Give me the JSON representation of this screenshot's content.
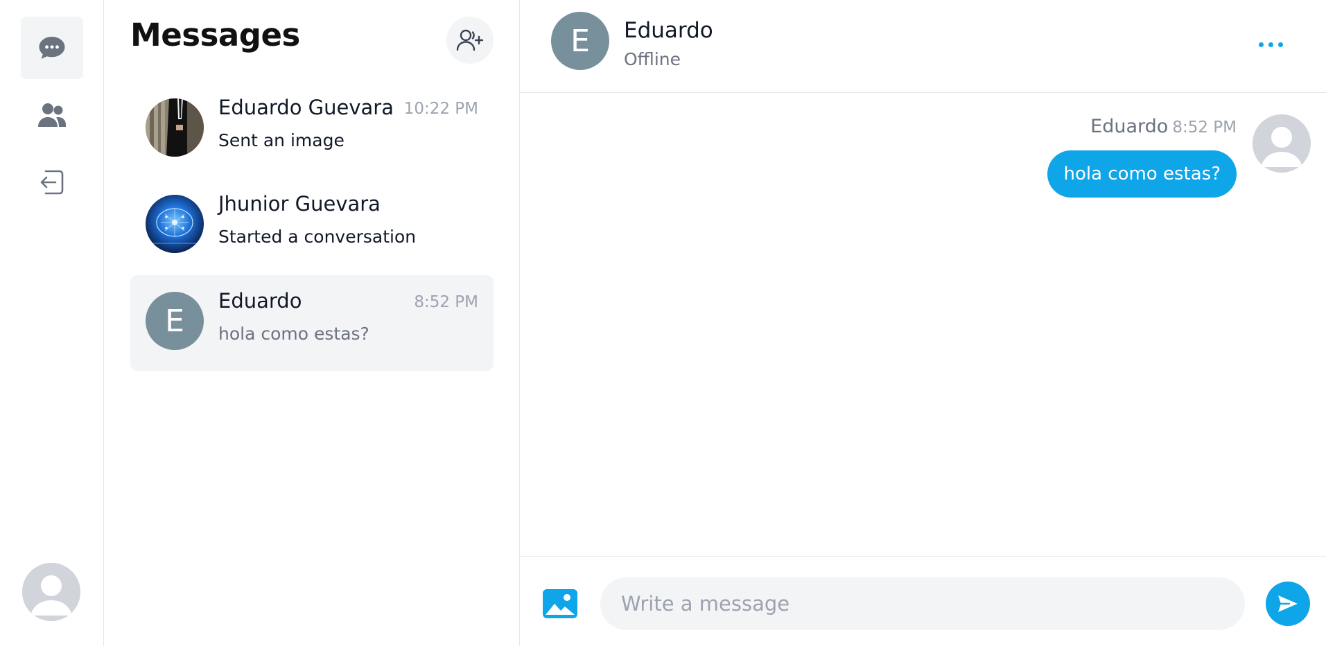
{
  "nav": {
    "items": [
      {
        "name": "messages",
        "icon": "chat-bubble-icon",
        "active": true
      },
      {
        "name": "contacts",
        "icon": "users-icon",
        "active": false
      },
      {
        "name": "logout",
        "icon": "logout-icon",
        "active": false
      }
    ],
    "user_avatar_icon": "default-user-icon"
  },
  "list": {
    "title": "Messages",
    "add_contact_icon": "user-plus-icon",
    "conversations": [
      {
        "name": "Eduardo Guevara",
        "time": "10:22 PM",
        "preview": "Sent an image",
        "avatar": "photo",
        "selected": false
      },
      {
        "name": "Jhunior Guevara",
        "time": "",
        "preview": "Started a conversation",
        "avatar": "photo",
        "selected": false
      },
      {
        "name": "Eduardo",
        "time": "8:52 PM",
        "preview": "hola como estas?",
        "avatar_letter": "E",
        "selected": true
      }
    ]
  },
  "chat": {
    "contact": {
      "name": "Eduardo",
      "status": "Offline",
      "avatar_letter": "E"
    },
    "more_icon": "more-horizontal-icon",
    "messages": [
      {
        "author": "Eduardo",
        "time": "8:52 PM",
        "text": "hola como estas?"
      }
    ],
    "composer": {
      "placeholder": "Write a message",
      "value": "",
      "image_icon": "image-icon",
      "send_icon": "send-icon"
    }
  },
  "colors": {
    "accent": "#0ea5e9",
    "avatar_gray": "#78909c",
    "selected_bg": "#f3f4f6",
    "border": "#e5e7eb"
  }
}
